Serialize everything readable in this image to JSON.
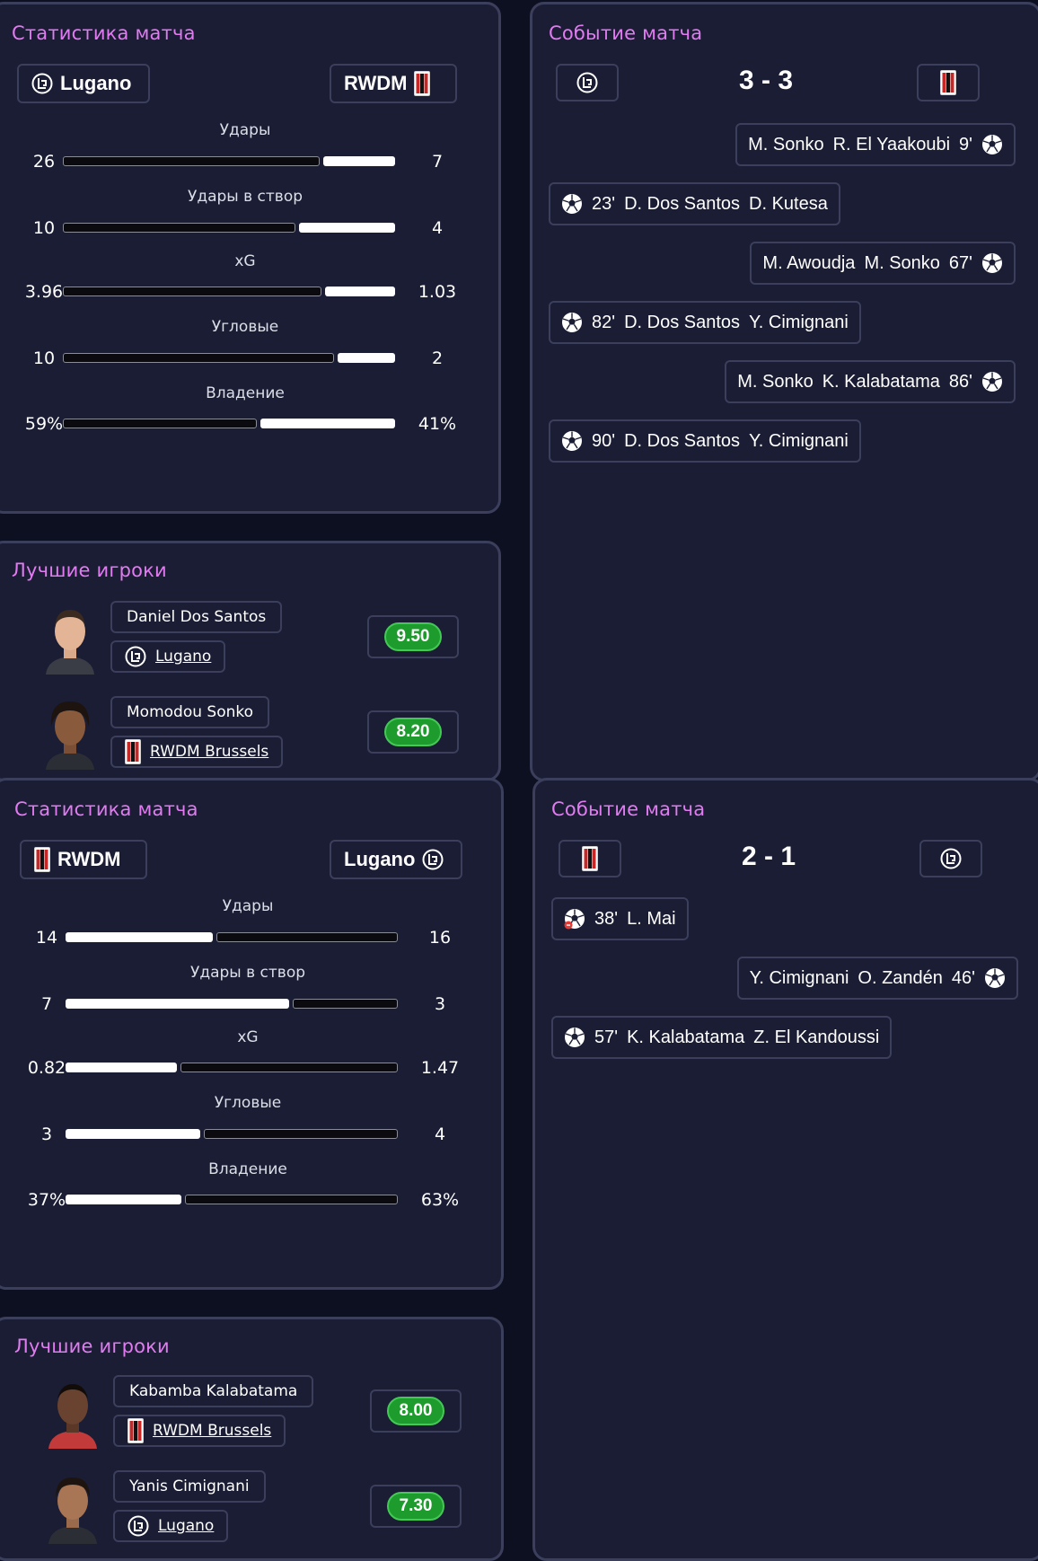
{
  "colors": {
    "panel_bg": "#1a1d33",
    "panel_border": "#3b3f5c",
    "title_color": "#e27bf2",
    "rating_green": "#1d9b2c"
  },
  "matches": [
    {
      "stats": {
        "title": "Статистика матча",
        "home_team": "Lugano",
        "away_team": "RWDM",
        "rows": [
          {
            "label": "Удары",
            "home": "26",
            "away": "7"
          },
          {
            "label": "Удары в створ",
            "home": "10",
            "away": "4"
          },
          {
            "label": "xG",
            "home": "3.96",
            "away": "1.03"
          },
          {
            "label": "Угловые",
            "home": "10",
            "away": "2"
          },
          {
            "label": "Владение",
            "home": "59%",
            "away": "41%"
          }
        ]
      },
      "events": {
        "title": "Событие матча",
        "score": "3 - 3",
        "home_logo": "lugano-logo-icon",
        "away_logo": "rwdm-logo-icon",
        "items": [
          {
            "side": "away",
            "type": "goal",
            "minute": "9'",
            "scorer": "R. El Yaakoubi",
            "assist": "M. Sonko"
          },
          {
            "side": "home",
            "type": "goal",
            "minute": "23'",
            "scorer": "D. Dos Santos",
            "assist": "D. Kutesa"
          },
          {
            "side": "away",
            "type": "goal",
            "minute": "67'",
            "scorer": "M. Sonko",
            "assist": "M. Awoudja"
          },
          {
            "side": "home",
            "type": "goal",
            "minute": "82'",
            "scorer": "D. Dos Santos",
            "assist": "Y. Cimignani"
          },
          {
            "side": "away",
            "type": "goal",
            "minute": "86'",
            "scorer": "K. Kalabatama",
            "assist": "M. Sonko"
          },
          {
            "side": "home",
            "type": "goal",
            "minute": "90'",
            "scorer": "D. Dos Santos",
            "assist": "Y. Cimignani"
          }
        ]
      },
      "best_players": {
        "title": "Лучшие игроки",
        "players": [
          {
            "name": "Daniel Dos Santos",
            "club": "Lugano",
            "club_logo": "lugano-logo-icon",
            "rating": "9.50"
          },
          {
            "name": "Momodou Sonko",
            "club": "RWDM Brussels",
            "club_logo": "rwdm-logo-icon",
            "rating": "8.20"
          }
        ]
      }
    },
    {
      "stats": {
        "title": "Статистика матча",
        "home_team": "RWDM",
        "away_team": "Lugano",
        "rows": [
          {
            "label": "Удары",
            "home": "14",
            "away": "16"
          },
          {
            "label": "Удары в створ",
            "home": "7",
            "away": "3"
          },
          {
            "label": "xG",
            "home": "0.82",
            "away": "1.47"
          },
          {
            "label": "Угловые",
            "home": "3",
            "away": "4"
          },
          {
            "label": "Владение",
            "home": "37%",
            "away": "63%"
          }
        ]
      },
      "events": {
        "title": "Событие матча",
        "score": "2 - 1",
        "home_logo": "rwdm-logo-icon",
        "away_logo": "lugano-logo-icon",
        "items": [
          {
            "side": "home",
            "type": "own-goal",
            "minute": "38'",
            "scorer": "L. Mai",
            "assist": ""
          },
          {
            "side": "away",
            "type": "goal",
            "minute": "46'",
            "scorer": "O. Zandén",
            "assist": "Y. Cimignani"
          },
          {
            "side": "home",
            "type": "goal",
            "minute": "57'",
            "scorer": "K. Kalabatama",
            "assist": "Z. El Kandoussi"
          }
        ]
      },
      "best_players": {
        "title": "Лучшие игроки",
        "players": [
          {
            "name": "Kabamba Kalabatama",
            "club": "RWDM Brussels",
            "club_logo": "rwdm-logo-icon",
            "rating": "8.00"
          },
          {
            "name": "Yanis Cimignani",
            "club": "Lugano",
            "club_logo": "lugano-logo-icon",
            "rating": "7.30"
          }
        ]
      }
    }
  ]
}
